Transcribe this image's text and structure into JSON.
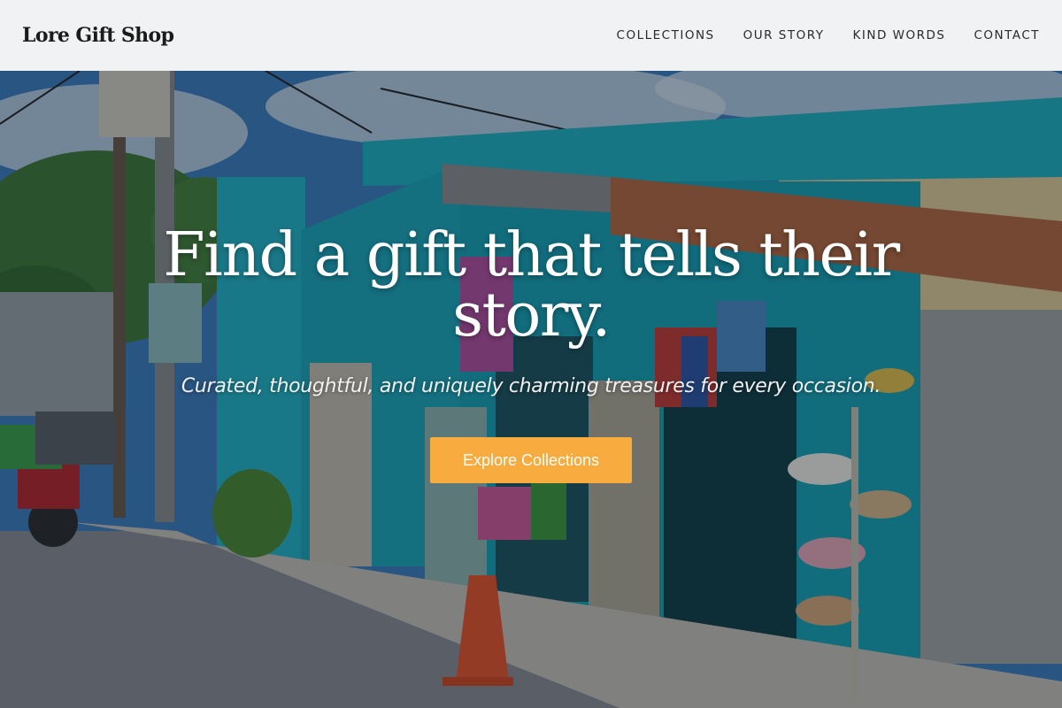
{
  "header": {
    "brand": "Lore Gift Shop",
    "nav": [
      "COLLECTIONS",
      "OUR STORY",
      "KIND WORDS",
      "CONTACT"
    ]
  },
  "hero": {
    "heading_line1": "Find a gift that tells their",
    "heading_line2": "story.",
    "subtitle": "Curated, thoughtful, and uniquely charming treasures for every occasion.",
    "cta_label": "Explore Collections",
    "background_description_icon": "storefront-photo"
  },
  "colors": {
    "header_bg": "#f8f9fa",
    "accent": "#f8ab3f",
    "text_on_hero": "#ffffff"
  }
}
